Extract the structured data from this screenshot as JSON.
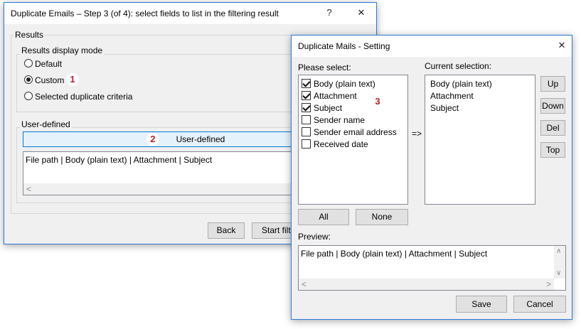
{
  "main_window": {
    "title": "Duplicate Emails – Step 3 (of 4): select fields to list in the filtering result",
    "help_label": "?",
    "close_label": "✕",
    "results_label": "Results",
    "display_mode_label": "Results display mode",
    "options": [
      "Default",
      "Custom",
      "Selected duplicate criteria"
    ],
    "selected_option": "Custom",
    "user_defined_label": "User-defined",
    "user_defined_button": "User-defined",
    "result_text": "File path | Body (plain text) | Attachment | Subject",
    "scroll_left": "<",
    "back_button": "Back",
    "start_button": "Start filte"
  },
  "setting_dialog": {
    "title": "Duplicate Mails - Setting",
    "close_label": "✕",
    "please_select_label": "Please select:",
    "fields": [
      {
        "label": "Body (plain text)",
        "checked": true
      },
      {
        "label": "Attachment",
        "checked": true
      },
      {
        "label": "Subject",
        "checked": true
      },
      {
        "label": "Sender name",
        "checked": false
      },
      {
        "label": "Sender email address",
        "checked": false
      },
      {
        "label": "Received date",
        "checked": false
      }
    ],
    "arrow_label": "=>",
    "current_selection_label": "Current selection:",
    "current_selection": [
      "Body (plain text)",
      "Attachment",
      "Subject"
    ],
    "up_button": "Up",
    "down_button": "Down",
    "del_button": "Del",
    "top_button": "Top",
    "all_button": "All",
    "none_button": "None",
    "preview_label": "Preview:",
    "preview_text": "File path | Body (plain text) | Attachment | Subject",
    "scroll_up": "∧",
    "scroll_down": "∨",
    "scroll_left": "<",
    "scroll_right": ">",
    "save_button": "Save",
    "cancel_button": "Cancel"
  },
  "badges": [
    "1",
    "2",
    "3"
  ],
  "colors": {
    "accent": "#0078d7",
    "badge_text": "#c02020",
    "border_blue": "#2b7ad6"
  }
}
